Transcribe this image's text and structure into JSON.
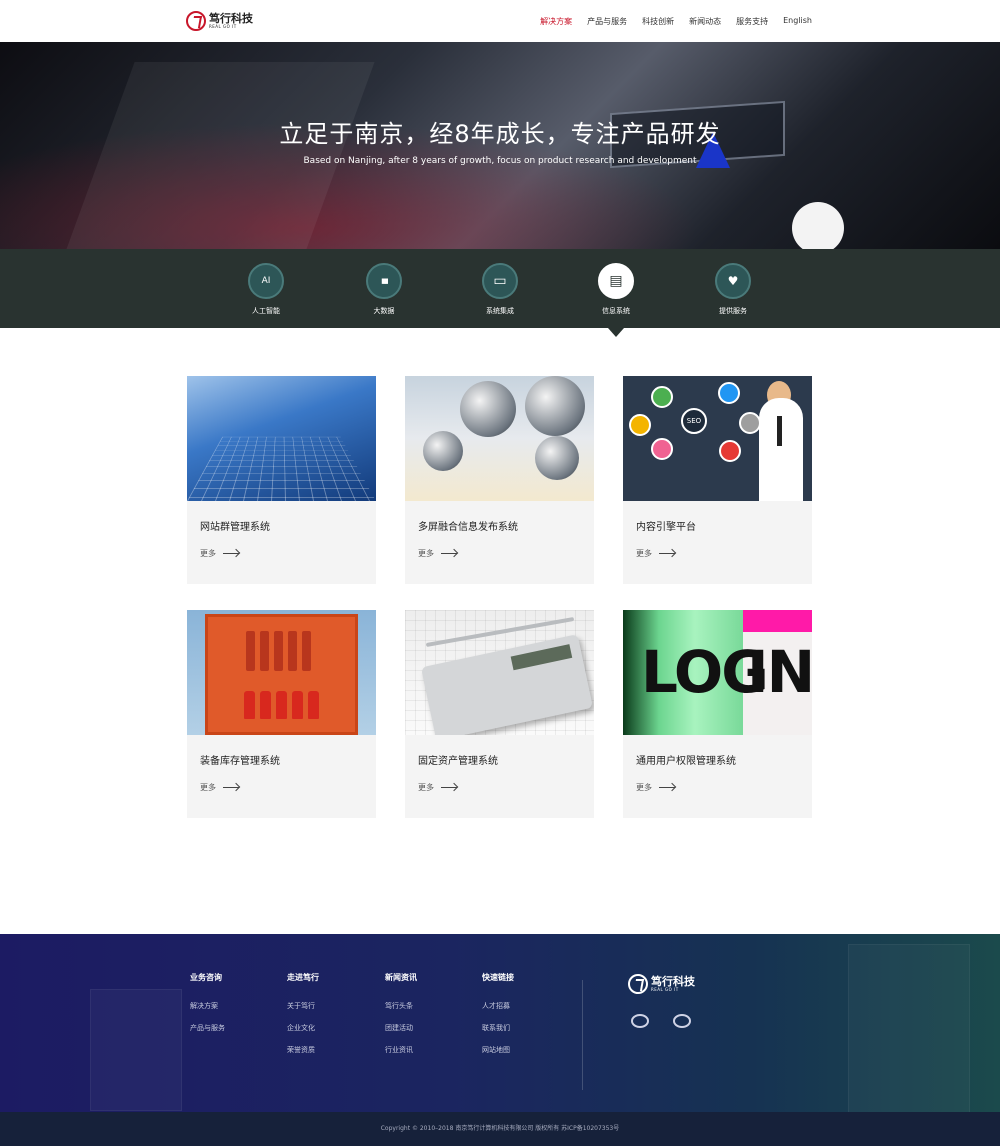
{
  "header": {
    "logo_text": "笃行科技",
    "logo_sub": "REAL GO IT",
    "nav": [
      {
        "label": "解决方案",
        "active": true
      },
      {
        "label": "产品与服务",
        "active": false
      },
      {
        "label": "科技创新",
        "active": false
      },
      {
        "label": "新闻动态",
        "active": false
      },
      {
        "label": "服务支持",
        "active": false
      },
      {
        "label": "English",
        "active": false
      }
    ]
  },
  "hero": {
    "title": "立足于南京，经8年成长，专注产品研发",
    "subtitle": "Based on Nanjing, after 8 years of growth, focus on product research and development"
  },
  "categories": [
    {
      "label": "人工智能",
      "icon": "ai-icon",
      "glyph": "AI"
    },
    {
      "label": "大数据",
      "icon": "bar-chart-icon",
      "glyph": "▮▮▮"
    },
    {
      "label": "系统集成",
      "icon": "server-icon",
      "glyph": "▭"
    },
    {
      "label": "信息系统",
      "icon": "dashboard-icon",
      "glyph": "▤",
      "active": true
    },
    {
      "label": "提供服务",
      "icon": "heart-icon",
      "glyph": "♥"
    }
  ],
  "cards": [
    {
      "title": "网站群管理系统",
      "more": "更多"
    },
    {
      "title": "多屏融合信息发布系统",
      "more": "更多"
    },
    {
      "title": "内容引擎平台",
      "more": "更多"
    },
    {
      "title": "装备库存管理系统",
      "more": "更多"
    },
    {
      "title": "固定资产管理系统",
      "more": "更多"
    },
    {
      "title": "通用用户权限管理系统",
      "more": "更多"
    }
  ],
  "card_image_text": {
    "log": "LOG",
    "in": "IN",
    "seo": "SEO"
  },
  "footer": {
    "columns": [
      {
        "heading": "业务咨询",
        "links": [
          "解决方案",
          "产品与服务"
        ]
      },
      {
        "heading": "走进笃行",
        "links": [
          "关于笃行",
          "企业文化",
          "荣誉资质"
        ]
      },
      {
        "heading": "新闻资讯",
        "links": [
          "笃行头条",
          "团建活动",
          "行业资讯"
        ]
      },
      {
        "heading": "快速链接",
        "links": [
          "人才招募",
          "联系我们",
          "网站地图"
        ]
      }
    ],
    "logo_text": "笃行科技",
    "logo_sub": "REAL GO IT",
    "social": [
      "wechat-icon",
      "weibo-icon"
    ],
    "copyright": "Copyright © 2010–2018 南京笃行计算机科技有限公司 版权所有 苏ICP备10207353号"
  }
}
